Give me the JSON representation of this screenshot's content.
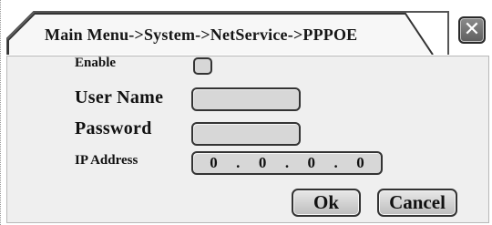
{
  "dialog": {
    "breadcrumb": "Main Menu->System->NetService->PPPOE",
    "close_icon": "close-icon"
  },
  "form": {
    "enable_label": "Enable",
    "enable_checked": false,
    "username_label": "User Name",
    "username_value": "",
    "password_label": "Password",
    "password_value": "",
    "ip_label": "IP Address",
    "ip_octets": [
      "0",
      ".",
      "0",
      ".",
      "0",
      ".",
      "0"
    ]
  },
  "buttons": {
    "ok_label": "Ok",
    "cancel_label": "Cancel"
  },
  "colors": {
    "title_bg": "#ffffff",
    "panel_bg": "#efefef",
    "field_bg": "#d7d7d7",
    "close_bg": "#6f6f6f"
  }
}
